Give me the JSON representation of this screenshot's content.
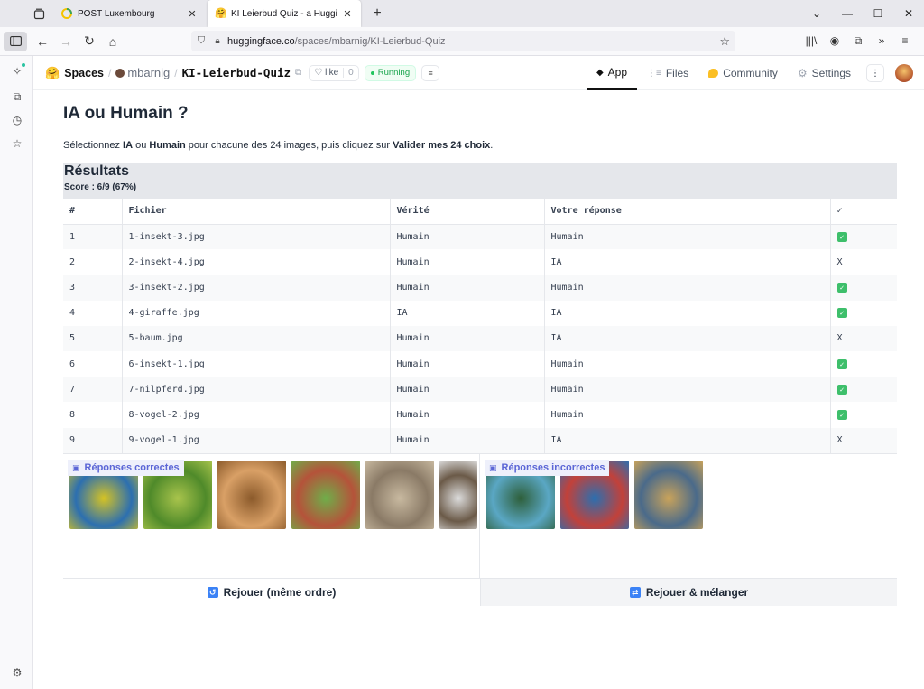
{
  "browser": {
    "tabs": [
      {
        "title": "POST Luxembourg",
        "active": false
      },
      {
        "title": "KI Leierbud Quiz - a Hugging Fa",
        "active": true
      }
    ],
    "url_host": "huggingface.co",
    "url_path": "/spaces/mbarnig/KI-Leierbud-Quiz"
  },
  "hf": {
    "spaces_label": "Spaces",
    "owner": "mbarnig",
    "repo": "KI-Leierbud-Quiz",
    "like_label": "like",
    "like_count": "0",
    "status": "Running",
    "tabs": {
      "app": "App",
      "files": "Files",
      "community": "Community",
      "settings": "Settings"
    }
  },
  "app": {
    "title": "IA ou Humain ?",
    "intro": {
      "p1": "Sélectionnez ",
      "b1": "IA",
      "p2": " ou ",
      "b2": "Humain",
      "p3": " pour chacune des 24 images, puis cliquez sur ",
      "b3": "Valider mes 24 choix",
      "p4": "."
    },
    "results_title": "Résultats",
    "score": "Score : 6/9 (67%)",
    "table": {
      "headers": [
        "#",
        "Fichier",
        "Vérité",
        "Votre réponse",
        "✓"
      ],
      "rows": [
        {
          "n": "1",
          "file": "1-insekt-3.jpg",
          "truth": "Humain",
          "answer": "Humain",
          "ok": true,
          "mark": "✓"
        },
        {
          "n": "2",
          "file": "2-insekt-4.jpg",
          "truth": "Humain",
          "answer": "IA",
          "ok": false,
          "mark": "X"
        },
        {
          "n": "3",
          "file": "3-insekt-2.jpg",
          "truth": "Humain",
          "answer": "Humain",
          "ok": true,
          "mark": "✓"
        },
        {
          "n": "4",
          "file": "4-giraffe.jpg",
          "truth": "IA",
          "answer": "IA",
          "ok": true,
          "mark": "✓"
        },
        {
          "n": "5",
          "file": "5-baum.jpg",
          "truth": "Humain",
          "answer": "IA",
          "ok": false,
          "mark": "X"
        },
        {
          "n": "6",
          "file": "6-insekt-1.jpg",
          "truth": "Humain",
          "answer": "Humain",
          "ok": true,
          "mark": "✓"
        },
        {
          "n": "7",
          "file": "7-nilpferd.jpg",
          "truth": "Humain",
          "answer": "Humain",
          "ok": true,
          "mark": "✓"
        },
        {
          "n": "8",
          "file": "8-vogel-2.jpg",
          "truth": "Humain",
          "answer": "Humain",
          "ok": true,
          "mark": "✓"
        },
        {
          "n": "9",
          "file": "9-vogel-1.jpg",
          "truth": "Humain",
          "answer": "IA",
          "ok": false,
          "mark": "X"
        }
      ]
    },
    "gallery_correct_label": "Réponses correctes",
    "gallery_incorrect_label": "Réponses incorrectes",
    "correct_thumbs": [
      {
        "icon": "butterfly-image",
        "colors": [
          "#2c6fb0",
          "#d6c323"
        ]
      },
      {
        "icon": "mantis-image",
        "colors": [
          "#4f8a2a",
          "#a9c44c"
        ]
      },
      {
        "icon": "giraffe-image",
        "colors": [
          "#d9a066",
          "#8b5a2b"
        ]
      },
      {
        "icon": "weevil-image",
        "colors": [
          "#b5533a",
          "#6fae4a"
        ]
      },
      {
        "icon": "hippo-image",
        "colors": [
          "#8a7a66",
          "#c8b9a0"
        ]
      },
      {
        "icon": "owl-image",
        "colors": [
          "#6b5a48",
          "#dcdcdc"
        ]
      }
    ],
    "incorrect_thumbs": [
      {
        "icon": "dragonfly-image",
        "colors": [
          "#5aa7c4",
          "#2e5f3a"
        ]
      },
      {
        "icon": "tree-rings-image",
        "colors": [
          "#c2413a",
          "#2b6fb0"
        ]
      },
      {
        "icon": "bird-image",
        "colors": [
          "#4a6a8a",
          "#caa35a"
        ]
      }
    ],
    "btn_replay": "Rejouer (même ordre)",
    "btn_shuffle": "Rejouer & mélanger"
  }
}
